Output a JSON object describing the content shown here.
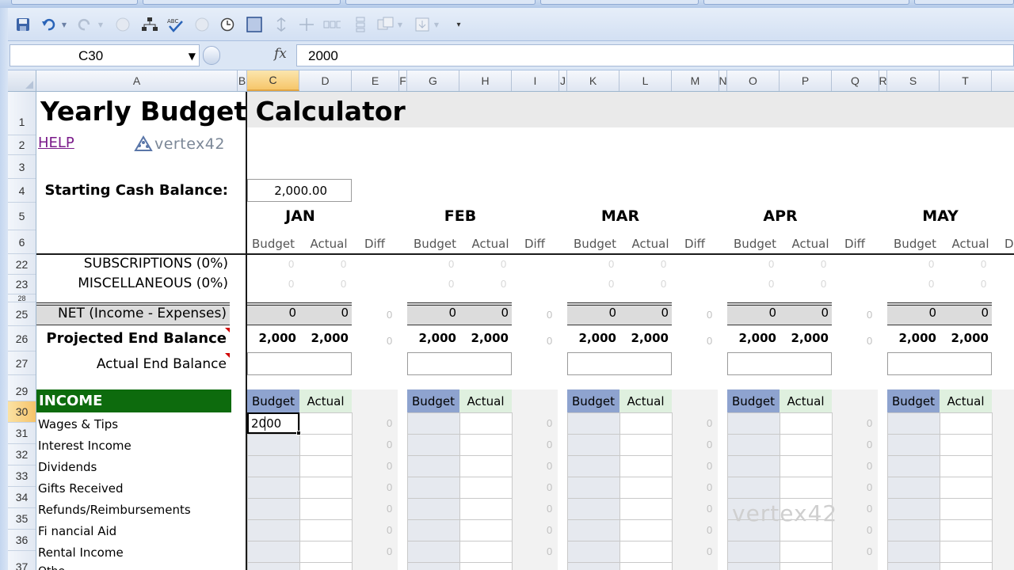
{
  "qat": {
    "icons": [
      "save-icon",
      "undo-icon",
      "redo-icon",
      "circle-icon",
      "org-chart-icon",
      "spell-check-icon",
      "circle-icon-2",
      "clock-icon",
      "square-icon",
      "sort-icon",
      "move-icon",
      "group-icon",
      "stack-icon",
      "arrange-icon",
      "export-icon",
      "customize-icon"
    ]
  },
  "formula_bar": {
    "name_box": "C30",
    "fx_label": "fx",
    "formula": "2000"
  },
  "columns": [
    "A",
    "B",
    "C",
    "D",
    "E",
    "F",
    "G",
    "H",
    "I",
    "J",
    "K",
    "L",
    "M",
    "N",
    "O",
    "P",
    "Q",
    "R",
    "S",
    "T"
  ],
  "rows": [
    "1",
    "2",
    "3",
    "4",
    "5",
    "6",
    "22",
    "23",
    "28",
    "25",
    "26",
    "27",
    "29",
    "30",
    "31",
    "32",
    "33",
    "34",
    "35",
    "36",
    "37"
  ],
  "sheet": {
    "title": "Yearly Budget Calculator",
    "help": "HELP",
    "logo": "vertex42",
    "starting_label": "Starting Cash Balance:",
    "starting_value": "2,000.00",
    "months": [
      "JAN",
      "FEB",
      "MAR",
      "APR",
      "MAY"
    ],
    "sub_budget": "Budget",
    "sub_actual": "Actual",
    "sub_diff": "Diff",
    "subscriptions": "SUBSCRIPTIONS (0%)",
    "misc": "MISCELLANEOUS (0%)",
    "net_label": "NET (Income - Expenses)",
    "projected_label": "Projected End Balance",
    "actual_end_label": "Actual End Balance",
    "income_label": "INCOME",
    "income_items": [
      "Wages & Tips",
      "Interest Income",
      "Dividends",
      "Gifts Received",
      "Refunds/Reimbursements",
      "Fi nancial Aid",
      "Rental Income"
    ],
    "zero": "0",
    "proj_value": "2,000",
    "active_cell_value": "2000",
    "watermark": "vertex42",
    "last_col_d": "D"
  },
  "colors": {
    "income_bg": "#0d6b0d",
    "budget_hdr": "#8ea3cf",
    "actual_hdr": "#dff0df",
    "selected_header": "#f6c66a"
  }
}
